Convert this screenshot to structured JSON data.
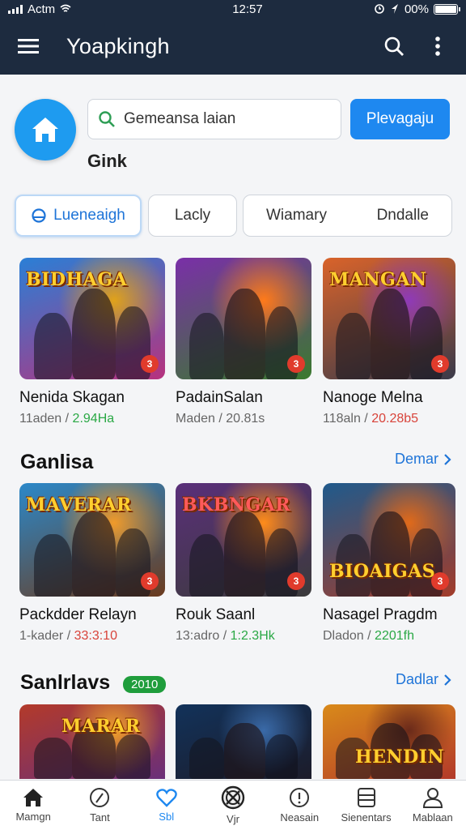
{
  "status_bar": {
    "carrier": "Actm",
    "time": "12:57",
    "battery": "00%"
  },
  "app_bar": {
    "title": "Yoapkingh",
    "menu_icon": "hamburger-icon",
    "search_icon": "search-icon",
    "more_icon": "more-vert-icon"
  },
  "top": {
    "home_icon": "home-icon",
    "search_value": "Gemeansa laian",
    "search_placeholder": "Gemeansa laian",
    "primary_button": "Plevagaju",
    "sub_label": "Gink"
  },
  "tabs": [
    {
      "label": "Lueneaigh",
      "icon": "info-icon",
      "active": true
    },
    {
      "label": "Lacly",
      "active": false
    },
    {
      "label": "Wiamary",
      "active": false
    },
    {
      "label": "Dndalle",
      "active": false
    }
  ],
  "featured": [
    {
      "title": "Nenida Skagan",
      "meta_a": "11aden",
      "meta_b": "2.94Ha",
      "art_title": "BIDHAGA",
      "badge": "3",
      "colors": [
        "#2a7fd6",
        "#e0a21a",
        "#b7327e"
      ]
    },
    {
      "title": "PadainSalan",
      "meta_a": "Maden",
      "meta_b": "20.81s",
      "art_title": "",
      "badge": "3",
      "colors": [
        "#7a2fa8",
        "#ff7a1a",
        "#3a7a2e"
      ]
    },
    {
      "title": "Nanoge Melna",
      "meta_a": "118aln",
      "meta_b": "20.28b5",
      "art_title": "MANGAN",
      "badge": "3",
      "colors": [
        "#d9632a",
        "#8f3ab8",
        "#3a3a4a"
      ]
    }
  ],
  "section_1": {
    "title": "Ganlisa",
    "link": "Demar",
    "items": [
      {
        "title": "Packdder Relayn",
        "meta_a": "1-kader",
        "meta_b": "33:3:10",
        "art_title": "MAVERAR",
        "badge": "3",
        "colors": [
          "#2b88c9",
          "#f09a2a",
          "#6b3b1e"
        ]
      },
      {
        "title": "Rouk Saanl",
        "meta_a": "13:adro",
        "meta_b": "1:2.3Hk",
        "art_title": "BKBNGAR",
        "badge": "3",
        "colors": [
          "#5a2f7a",
          "#ff8c1a",
          "#3b3b3b"
        ]
      },
      {
        "title": "Nasagel Pragdm",
        "meta_a": "Dladon",
        "meta_b": "2201fh",
        "art_title": "BIOAIGAS",
        "badge": "3",
        "colors": [
          "#1f5a8c",
          "#e06a1a",
          "#a33c2a"
        ]
      }
    ]
  },
  "section_2": {
    "title": "Sanlrlavs",
    "badge": "2010",
    "link": "Dadlar",
    "items": [
      {
        "art_title": "MARAR",
        "colors": [
          "#b33a2a",
          "#f0a02a",
          "#6a2f7a"
        ]
      },
      {
        "art_title": "",
        "colors": [
          "#12325a",
          "#3a6aa8",
          "#1c1c2a"
        ]
      },
      {
        "art_title": "HENDIN",
        "colors": [
          "#d98a1a",
          "#6a2a1a",
          "#b33a2a"
        ]
      }
    ]
  },
  "bottom_nav": [
    {
      "label": "Mamgn",
      "icon": "home-icon",
      "active": false
    },
    {
      "label": "Tant",
      "icon": "gauge-icon",
      "active": false
    },
    {
      "label": "Sbl",
      "icon": "heart-icon",
      "active": true
    },
    {
      "label": "Vjr",
      "icon": "target-icon",
      "active": false
    },
    {
      "label": "Neasain",
      "icon": "alert-circle-icon",
      "active": false
    },
    {
      "label": "Sienentars",
      "icon": "list-box-icon",
      "active": false
    },
    {
      "label": "Mablaan",
      "icon": "person-icon",
      "active": false
    }
  ]
}
